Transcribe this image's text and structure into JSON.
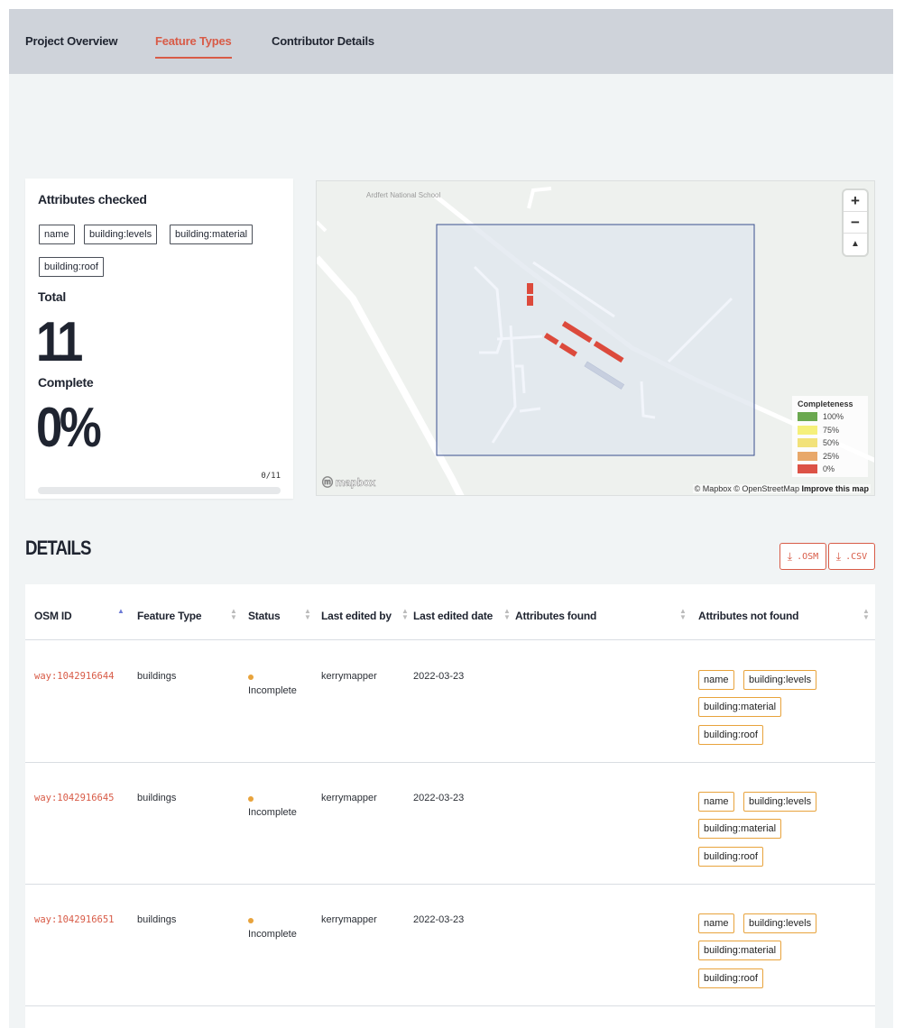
{
  "tabs": [
    {
      "label": "Project Overview",
      "active": false
    },
    {
      "label": "Feature Types",
      "active": true
    },
    {
      "label": "Contributor Details",
      "active": false
    }
  ],
  "summary": {
    "title": "Attributes checked",
    "attributes": [
      "name",
      "building:levels",
      "building:material",
      "building:roof"
    ],
    "total_label": "Total",
    "total_value": "11",
    "complete_label": "Complete",
    "complete_value": "0%",
    "progress_text": "0/11",
    "progress_fraction": 0
  },
  "map": {
    "place_label": "Ardfert National School",
    "legend_title": "Completeness",
    "legend": [
      {
        "label": "100%",
        "color": "#6aa84f"
      },
      {
        "label": "75%",
        "color": "#f5f07a"
      },
      {
        "label": "50%",
        "color": "#f2e27a"
      },
      {
        "label": "25%",
        "color": "#e8a86a"
      },
      {
        "label": "0%",
        "color": "#dc5246"
      }
    ],
    "logo": "mapbox",
    "attribution": "© Mapbox © OpenStreetMap",
    "improve": "Improve this map",
    "feature_color": "#dc4a3c"
  },
  "details": {
    "title": "DETAILS",
    "download_osm": ".OSM",
    "download_csv": ".CSV",
    "columns": [
      "OSM ID",
      "Feature Type",
      "Status",
      "Last edited by",
      "Last edited date",
      "Attributes found",
      "Attributes not found"
    ],
    "rows": [
      {
        "osm_id": "way:1042916644",
        "feature_type": "buildings",
        "status": "Incomplete",
        "editor": "kerrymapper",
        "date": "2022-03-23",
        "found": [],
        "not_found": [
          "name",
          "building:levels",
          "building:material",
          "building:roof"
        ]
      },
      {
        "osm_id": "way:1042916645",
        "feature_type": "buildings",
        "status": "Incomplete",
        "editor": "kerrymapper",
        "date": "2022-03-23",
        "found": [],
        "not_found": [
          "name",
          "building:levels",
          "building:material",
          "building:roof"
        ]
      },
      {
        "osm_id": "way:1042916651",
        "feature_type": "buildings",
        "status": "Incomplete",
        "editor": "kerrymapper",
        "date": "2022-03-23",
        "found": [],
        "not_found": [
          "name",
          "building:levels",
          "building:material",
          "building:roof"
        ]
      }
    ]
  },
  "colors": {
    "accent": "#d85b47",
    "tag_border": "#e8a33c",
    "status_incomplete": "#e8a33c"
  }
}
